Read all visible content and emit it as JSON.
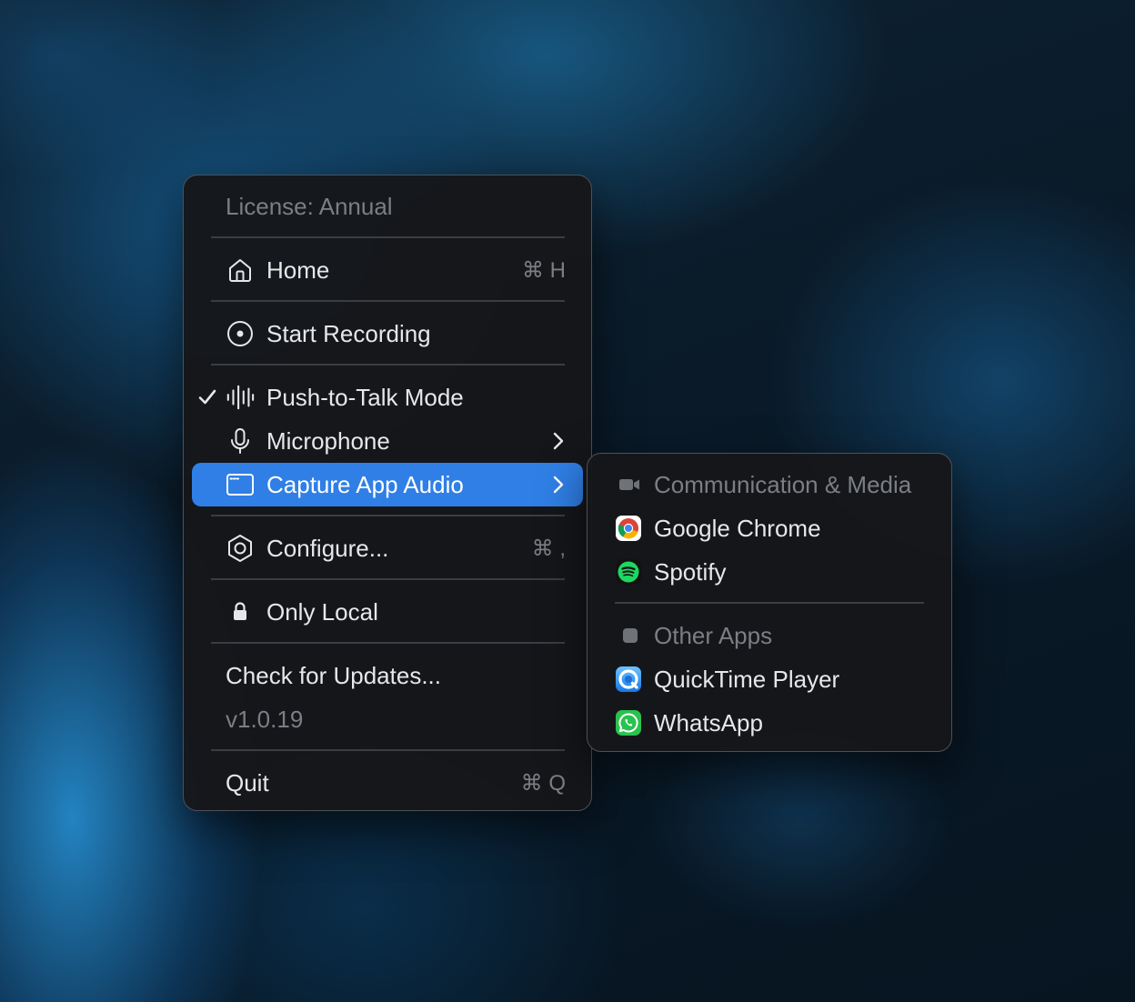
{
  "menu": {
    "license": "License: Annual",
    "home": {
      "label": "Home",
      "shortcut": "⌘ H"
    },
    "start_recording": {
      "label": "Start Recording"
    },
    "push_to_talk": {
      "label": "Push-to-Talk Mode",
      "checked": true
    },
    "microphone": {
      "label": "Microphone"
    },
    "capture_app_audio": {
      "label": "Capture App Audio",
      "highlighted": true
    },
    "configure": {
      "label": "Configure...",
      "shortcut": "⌘ ,"
    },
    "only_local": {
      "label": "Only Local"
    },
    "check_updates": {
      "label": "Check for Updates..."
    },
    "version": "v1.0.19",
    "quit": {
      "label": "Quit",
      "shortcut": "⌘ Q"
    }
  },
  "submenu": {
    "section_media": "Communication & Media",
    "media_apps": [
      {
        "label": "Google Chrome",
        "icon": "chrome-icon"
      },
      {
        "label": "Spotify",
        "icon": "spotify-icon"
      }
    ],
    "section_other": "Other Apps",
    "other_apps": [
      {
        "label": "QuickTime Player",
        "icon": "quicktime-icon"
      },
      {
        "label": "WhatsApp",
        "icon": "whatsapp-icon"
      }
    ]
  },
  "colors": {
    "highlight": "#2f7fe6",
    "menu_bg": "#16171a",
    "text": "#e6e7e9",
    "dim_text": "#7b7e83"
  }
}
